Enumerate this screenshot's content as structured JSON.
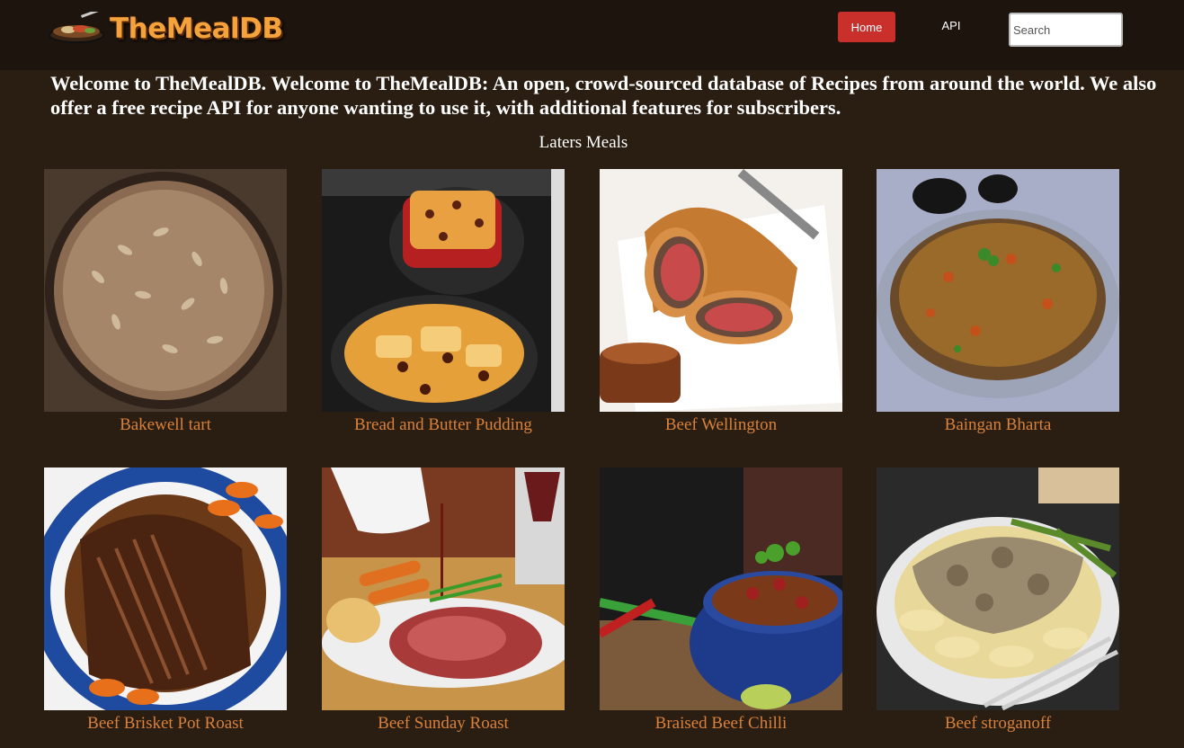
{
  "header": {
    "logo_text": "TheMealDB",
    "nav": {
      "home_label": "Home",
      "api_label": "API"
    },
    "search": {
      "placeholder": "Search",
      "value": ""
    }
  },
  "welcome_text": "Welcome to TheMealDB. Welcome to TheMealDB: An open, crowd-sourced database of Recipes from around the world. We also offer a free recipe API for anyone wanting to use it, with additional features for subscribers.",
  "section_title": "Laters Meals",
  "meals": [
    {
      "name": "Bakewell tart"
    },
    {
      "name": "Bread and Butter Pudding"
    },
    {
      "name": "Beef Wellington"
    },
    {
      "name": "Baingan Bharta"
    },
    {
      "name": "Beef Brisket Pot Roast"
    },
    {
      "name": "Beef Sunday Roast"
    },
    {
      "name": "Braised Beef Chilli"
    },
    {
      "name": "Beef stroganoff"
    }
  ],
  "colors": {
    "background": "#2a1d12",
    "navbar": "#1c140d",
    "accent": "#c9302c",
    "caption": "#d8813a",
    "logo": "#f3a23c"
  }
}
